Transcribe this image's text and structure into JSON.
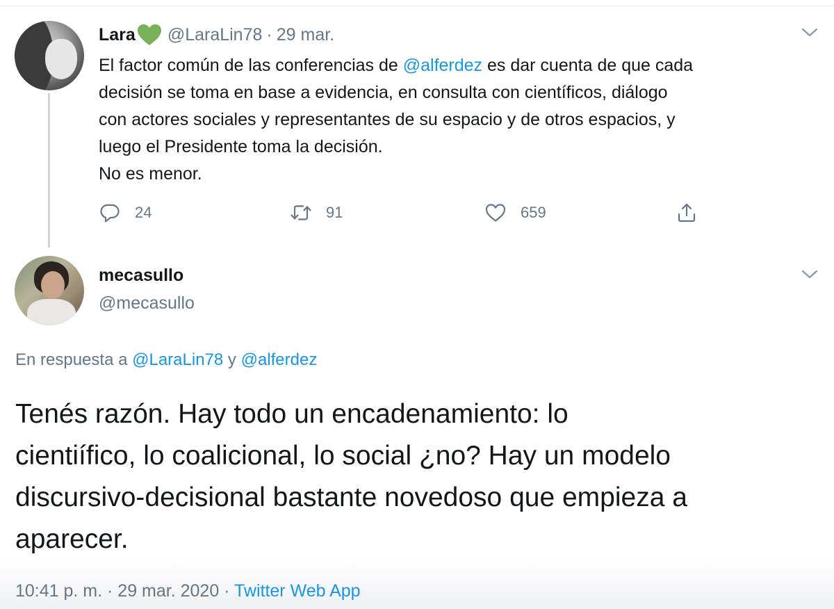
{
  "tweet1": {
    "author_name": "Lara",
    "author_handle": "@LaraLin78",
    "separator": "·",
    "date": "29 mar.",
    "text_lines": [
      {
        "before": "El factor común de las conferencias de ",
        "mention": "@alferdez",
        "after": " es dar cuenta de que cada"
      },
      {
        "before": "decisión se toma en base a evidencia, en consulta con científicos, diálogo",
        "mention": "",
        "after": ""
      },
      {
        "before": "con actores sociales y representantes de su espacio y de otros espacios, y",
        "mention": "",
        "after": ""
      },
      {
        "before": "luego el Presidente toma la decisión.",
        "mention": "",
        "after": ""
      },
      {
        "before": "No es menor.",
        "mention": "",
        "after": ""
      }
    ],
    "actions": {
      "replies": "24",
      "retweets": "91",
      "likes": "659"
    }
  },
  "tweet2": {
    "author_name": "mecasullo",
    "author_handle": "@mecasullo",
    "reply_to": {
      "prefix": "En respuesta a ",
      "mention1": "@LaraLin78",
      "joiner": " y ",
      "mention2": "@alferdez"
    },
    "text_lines": [
      "Tenés razón. Hay todo un encadenamiento: lo",
      "cientiífico, lo coalicional, lo social ¿no? Hay un modelo",
      "discursivo-decisional bastante novedoso que empieza a",
      "aparecer."
    ],
    "time": "10:41 p. m.",
    "separator": " · ",
    "date": "29 mar. 2020",
    "source_separator": " · ",
    "source": "Twitter Web App"
  },
  "icons": {
    "reply": "reply-icon",
    "retweet": "retweet-icon",
    "like": "heart-icon",
    "share": "share-icon",
    "more": "chevron-down-icon",
    "name_emoji": "green-heart-emoji"
  },
  "colors": {
    "text": "#14171a",
    "secondary": "#657786",
    "link": "#1b95e0",
    "divider": "#ccd6dd",
    "heart_green": "#78b159"
  }
}
